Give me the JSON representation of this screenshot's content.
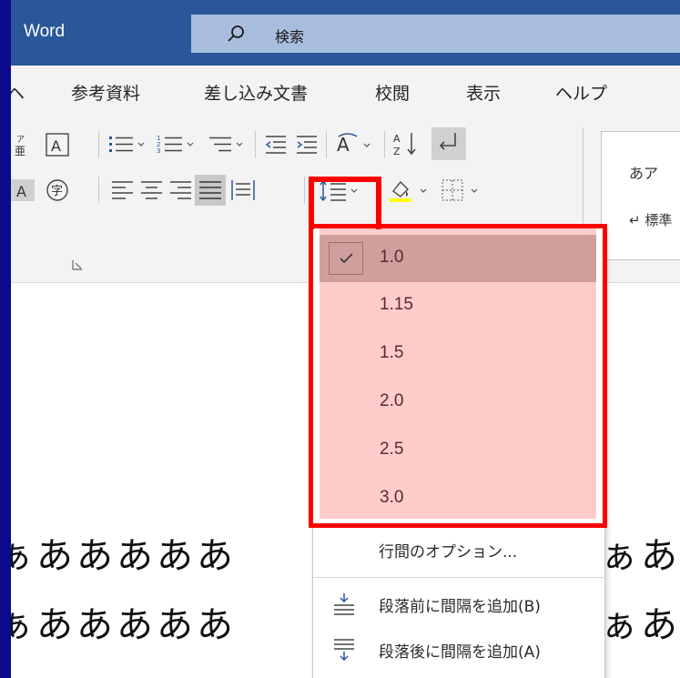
{
  "app": {
    "name": "Word"
  },
  "search": {
    "text": "検索"
  },
  "tabs": [
    "ヘ",
    "参考資料",
    "差し込み文書",
    "校閲",
    "表示",
    "ヘルプ"
  ],
  "styles_gallery": {
    "sample_top": "あア",
    "sample_bottom": "↵ 標準"
  },
  "document": {
    "lines_left": [
      "ぁあああああ",
      "ぁあああああ"
    ],
    "lines_right": [
      "ぁあ",
      "ぁあ"
    ]
  },
  "line_spacing_menu": {
    "options": [
      {
        "label": "1.0",
        "selected": true
      },
      {
        "label": "1.15",
        "selected": false
      },
      {
        "label": "1.5",
        "selected": false
      },
      {
        "label": "2.0",
        "selected": false
      },
      {
        "label": "2.5",
        "selected": false
      },
      {
        "label": "3.0",
        "selected": false
      }
    ],
    "line_options_label": "行間のオプション...",
    "add_before_label": "段落前に間隔を追加(B)",
    "add_after_label": "段落後に間隔を追加(A)"
  },
  "colors": {
    "title_bar": "#2b579a",
    "highlight": "#ffcccc",
    "selected": "#d19e9e",
    "annotation": "#ff0000"
  }
}
